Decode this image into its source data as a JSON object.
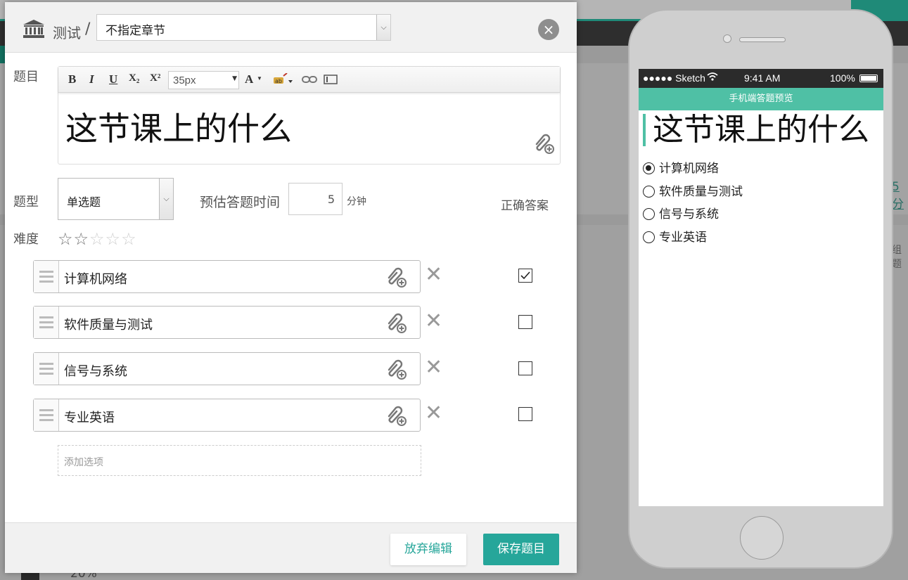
{
  "header": {
    "crumb_test": "测试",
    "separator": "/",
    "chapter_value": "不指定章节",
    "close_label": "×"
  },
  "form": {
    "question_label": "题目",
    "font_size_value": "35px",
    "question_text": "这节课上的什么",
    "type_label": "题型",
    "type_value": "单选题",
    "time_label": "预估答题时间",
    "time_value": "5",
    "time_unit": "分钟",
    "correct_label": "正确答案",
    "difficulty_label": "难度",
    "difficulty": {
      "value": 2,
      "max": 5
    },
    "options": [
      {
        "text": "计算机网络",
        "correct": true
      },
      {
        "text": "软件质量与测试",
        "correct": false
      },
      {
        "text": "信号与系统",
        "correct": false
      },
      {
        "text": "专业英语",
        "correct": false
      }
    ],
    "add_option_placeholder": "添加选项"
  },
  "toolbar": {
    "bold": "B",
    "italic": "I",
    "underline": "U",
    "subscript": "X₂",
    "superscript": "X²",
    "font_color": "A"
  },
  "footer": {
    "discard_label": "放弃编辑",
    "save_label": "保存题目"
  },
  "preview": {
    "carrier": "●●●●● Sketch",
    "time": "9:41 AM",
    "battery": "100%",
    "bar_title": "手机端答题预览",
    "title": "这节课上的什么",
    "options": [
      "计算机网络",
      "软件质量与测试",
      "信号与系统",
      "专业英语"
    ],
    "selected_index": 0
  },
  "background": {
    "percent": "20%",
    "side_text": "组题",
    "link_text": "5 分"
  },
  "colors": {
    "accent": "#26a69a",
    "preview_bar": "#4fc0a5",
    "dark_bar": "#2e2e2e"
  }
}
